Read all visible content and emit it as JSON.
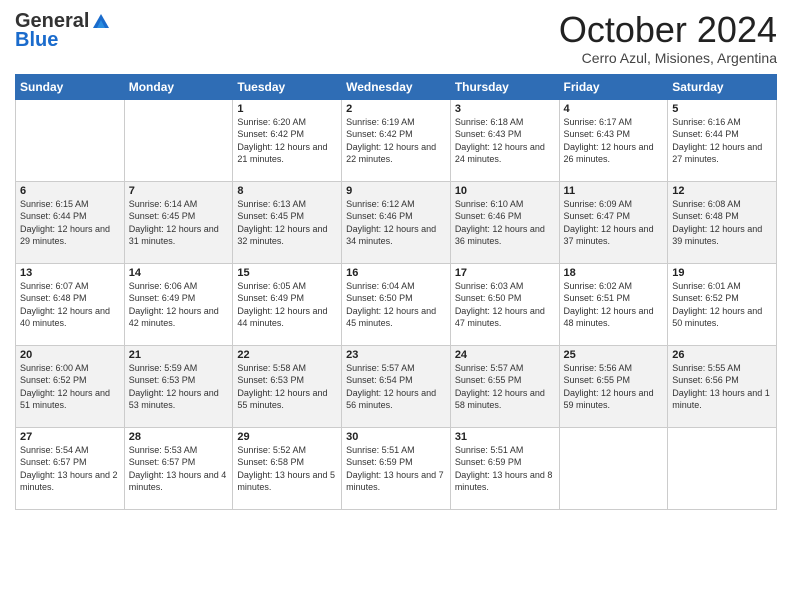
{
  "logo": {
    "general": "General",
    "blue": "Blue"
  },
  "header": {
    "month": "October 2024",
    "location": "Cerro Azul, Misiones, Argentina"
  },
  "days": [
    "Sunday",
    "Monday",
    "Tuesday",
    "Wednesday",
    "Thursday",
    "Friday",
    "Saturday"
  ],
  "weeks": [
    [
      {
        "day": "",
        "content": ""
      },
      {
        "day": "",
        "content": ""
      },
      {
        "day": "1",
        "content": "Sunrise: 6:20 AM\nSunset: 6:42 PM\nDaylight: 12 hours and 21 minutes."
      },
      {
        "day": "2",
        "content": "Sunrise: 6:19 AM\nSunset: 6:42 PM\nDaylight: 12 hours and 22 minutes."
      },
      {
        "day": "3",
        "content": "Sunrise: 6:18 AM\nSunset: 6:43 PM\nDaylight: 12 hours and 24 minutes."
      },
      {
        "day": "4",
        "content": "Sunrise: 6:17 AM\nSunset: 6:43 PM\nDaylight: 12 hours and 26 minutes."
      },
      {
        "day": "5",
        "content": "Sunrise: 6:16 AM\nSunset: 6:44 PM\nDaylight: 12 hours and 27 minutes."
      }
    ],
    [
      {
        "day": "6",
        "content": "Sunrise: 6:15 AM\nSunset: 6:44 PM\nDaylight: 12 hours and 29 minutes."
      },
      {
        "day": "7",
        "content": "Sunrise: 6:14 AM\nSunset: 6:45 PM\nDaylight: 12 hours and 31 minutes."
      },
      {
        "day": "8",
        "content": "Sunrise: 6:13 AM\nSunset: 6:45 PM\nDaylight: 12 hours and 32 minutes."
      },
      {
        "day": "9",
        "content": "Sunrise: 6:12 AM\nSunset: 6:46 PM\nDaylight: 12 hours and 34 minutes."
      },
      {
        "day": "10",
        "content": "Sunrise: 6:10 AM\nSunset: 6:46 PM\nDaylight: 12 hours and 36 minutes."
      },
      {
        "day": "11",
        "content": "Sunrise: 6:09 AM\nSunset: 6:47 PM\nDaylight: 12 hours and 37 minutes."
      },
      {
        "day": "12",
        "content": "Sunrise: 6:08 AM\nSunset: 6:48 PM\nDaylight: 12 hours and 39 minutes."
      }
    ],
    [
      {
        "day": "13",
        "content": "Sunrise: 6:07 AM\nSunset: 6:48 PM\nDaylight: 12 hours and 40 minutes."
      },
      {
        "day": "14",
        "content": "Sunrise: 6:06 AM\nSunset: 6:49 PM\nDaylight: 12 hours and 42 minutes."
      },
      {
        "day": "15",
        "content": "Sunrise: 6:05 AM\nSunset: 6:49 PM\nDaylight: 12 hours and 44 minutes."
      },
      {
        "day": "16",
        "content": "Sunrise: 6:04 AM\nSunset: 6:50 PM\nDaylight: 12 hours and 45 minutes."
      },
      {
        "day": "17",
        "content": "Sunrise: 6:03 AM\nSunset: 6:50 PM\nDaylight: 12 hours and 47 minutes."
      },
      {
        "day": "18",
        "content": "Sunrise: 6:02 AM\nSunset: 6:51 PM\nDaylight: 12 hours and 48 minutes."
      },
      {
        "day": "19",
        "content": "Sunrise: 6:01 AM\nSunset: 6:52 PM\nDaylight: 12 hours and 50 minutes."
      }
    ],
    [
      {
        "day": "20",
        "content": "Sunrise: 6:00 AM\nSunset: 6:52 PM\nDaylight: 12 hours and 51 minutes."
      },
      {
        "day": "21",
        "content": "Sunrise: 5:59 AM\nSunset: 6:53 PM\nDaylight: 12 hours and 53 minutes."
      },
      {
        "day": "22",
        "content": "Sunrise: 5:58 AM\nSunset: 6:53 PM\nDaylight: 12 hours and 55 minutes."
      },
      {
        "day": "23",
        "content": "Sunrise: 5:57 AM\nSunset: 6:54 PM\nDaylight: 12 hours and 56 minutes."
      },
      {
        "day": "24",
        "content": "Sunrise: 5:57 AM\nSunset: 6:55 PM\nDaylight: 12 hours and 58 minutes."
      },
      {
        "day": "25",
        "content": "Sunrise: 5:56 AM\nSunset: 6:55 PM\nDaylight: 12 hours and 59 minutes."
      },
      {
        "day": "26",
        "content": "Sunrise: 5:55 AM\nSunset: 6:56 PM\nDaylight: 13 hours and 1 minute."
      }
    ],
    [
      {
        "day": "27",
        "content": "Sunrise: 5:54 AM\nSunset: 6:57 PM\nDaylight: 13 hours and 2 minutes."
      },
      {
        "day": "28",
        "content": "Sunrise: 5:53 AM\nSunset: 6:57 PM\nDaylight: 13 hours and 4 minutes."
      },
      {
        "day": "29",
        "content": "Sunrise: 5:52 AM\nSunset: 6:58 PM\nDaylight: 13 hours and 5 minutes."
      },
      {
        "day": "30",
        "content": "Sunrise: 5:51 AM\nSunset: 6:59 PM\nDaylight: 13 hours and 7 minutes."
      },
      {
        "day": "31",
        "content": "Sunrise: 5:51 AM\nSunset: 6:59 PM\nDaylight: 13 hours and 8 minutes."
      },
      {
        "day": "",
        "content": ""
      },
      {
        "day": "",
        "content": ""
      }
    ]
  ]
}
